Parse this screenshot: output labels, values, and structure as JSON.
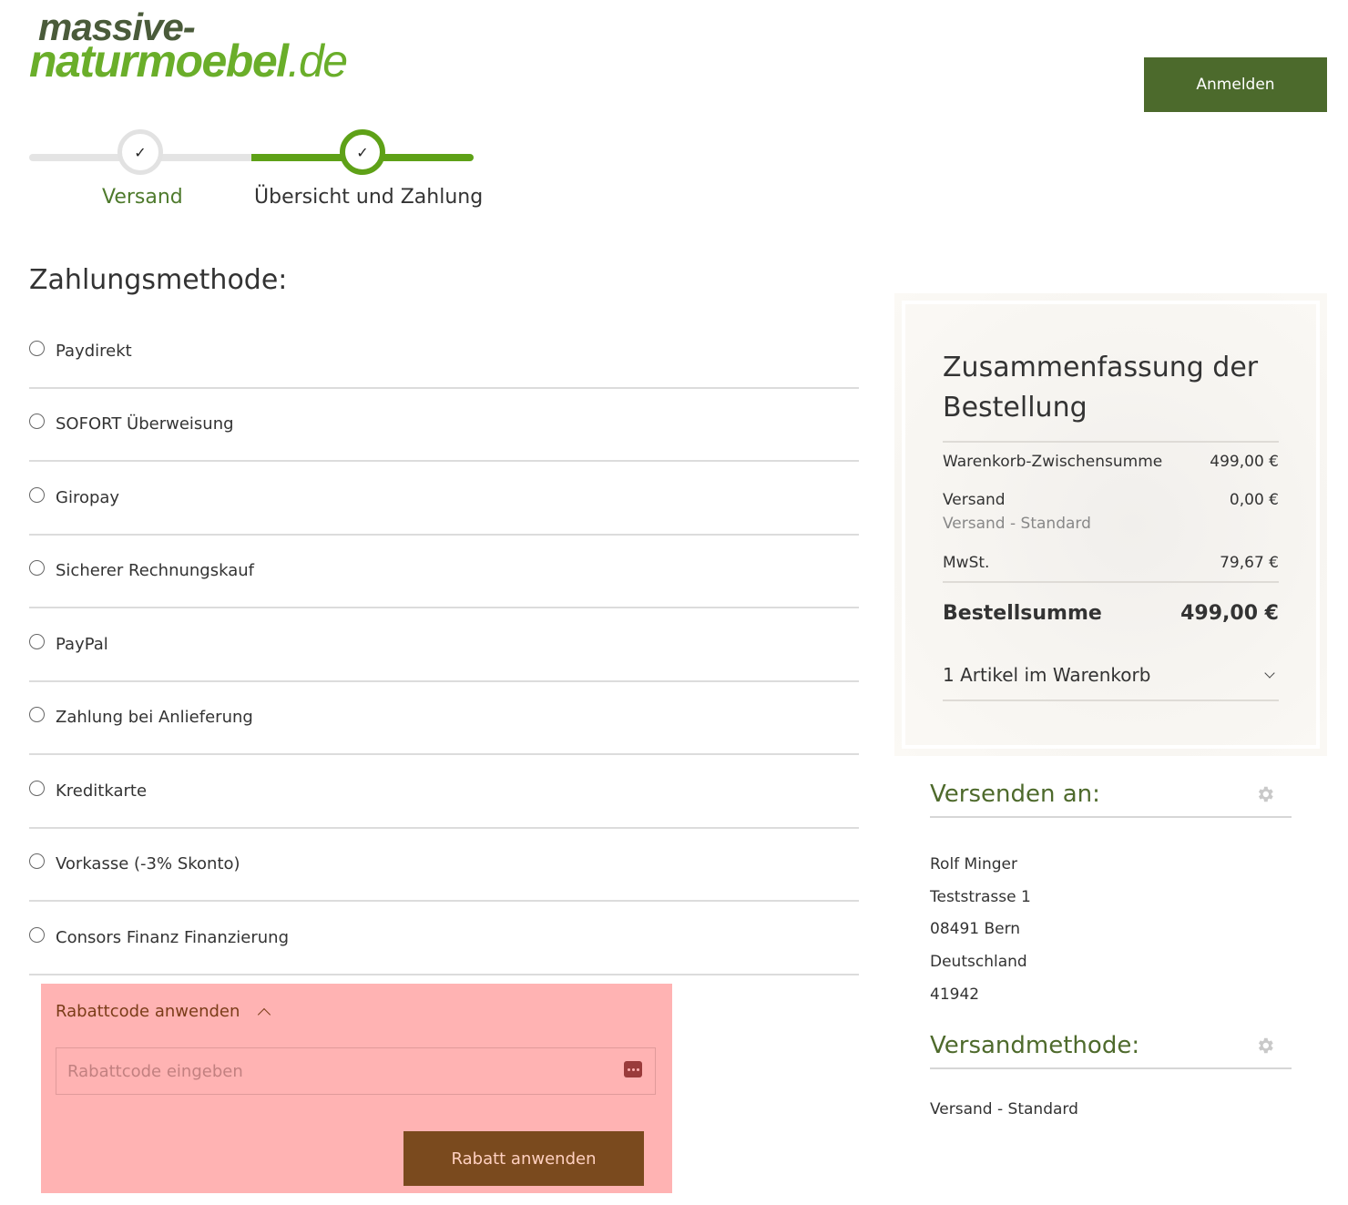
{
  "header": {
    "logo_line1": "massive-",
    "logo_line2": "naturmoebel",
    "logo_tld": ".de",
    "login_label": "Anmelden"
  },
  "progress": {
    "steps": [
      {
        "label": "Versand",
        "check": "✓"
      },
      {
        "label": "Übersicht und Zahlung",
        "check": "✓"
      }
    ]
  },
  "payment": {
    "title": "Zahlungsmethode:",
    "methods": [
      "Paydirekt",
      "SOFORT Überweisung",
      "Giropay",
      "Sicherer Rechnungskauf",
      "PayPal",
      "Zahlung bei Anlieferung",
      "Kreditkarte",
      "Vorkasse (-3% Skonto)",
      "Consors Finanz Finanzierung"
    ]
  },
  "discount": {
    "toggle_label": "Rabattcode anwenden",
    "input_placeholder": "Rabattcode eingeben",
    "apply_label": "Rabatt anwenden",
    "background": "#ffb3b3"
  },
  "summary": {
    "title": "Zusammenfassung der Bestellung",
    "subtotal_label": "Warenkorb-Zwischensumme",
    "subtotal_value": "499,00 €",
    "shipping_label": "Versand",
    "shipping_value": "0,00 €",
    "shipping_method": "Versand - Standard",
    "tax_label": "MwSt.",
    "tax_value": "79,67 €",
    "total_label": "Bestellsumme",
    "total_value": "499,00 €",
    "cart_toggle": "1 Artikel im Warenkorb"
  },
  "ship_to": {
    "title": "Versenden an:",
    "address": [
      "Rolf Minger",
      "Teststrasse 1",
      "08491 Bern",
      "Deutschland",
      "41942"
    ]
  },
  "ship_method": {
    "title": "Versandmethode:",
    "value": "Versand - Standard"
  },
  "colors": {
    "brand_green": "#4c6a2c",
    "progress_green": "#5ea117",
    "discount_button": "#7a4a1e"
  }
}
